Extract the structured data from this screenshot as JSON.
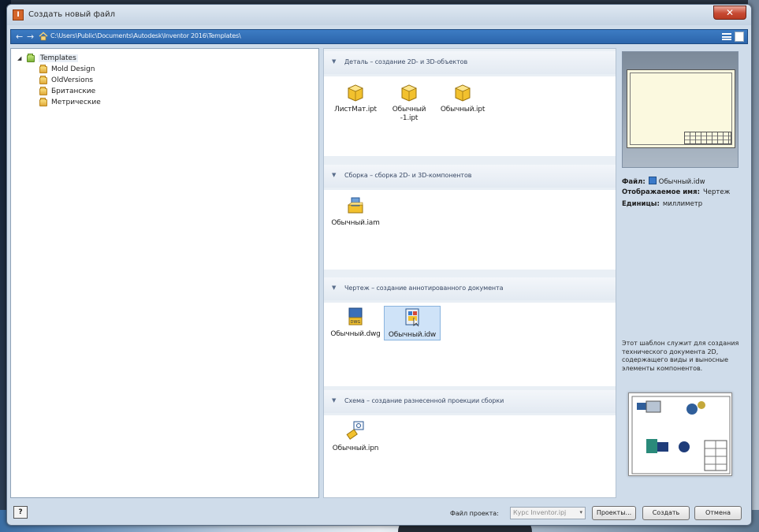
{
  "window": {
    "title": "Создать новый файл",
    "app_icon_glyph": "I",
    "close_glyph": "✕"
  },
  "address_bar": {
    "back_glyph": "←",
    "forward_glyph": "→",
    "path": "C:\\Users\\Public\\Documents\\Autodesk\\Inventor 2016\\Templates\\"
  },
  "tree": {
    "root": {
      "label": "Templates",
      "expander": "◢"
    },
    "children": [
      {
        "label": "Mold Design"
      },
      {
        "label": "OldVersions"
      },
      {
        "label": "Британские"
      },
      {
        "label": "Метрические"
      }
    ]
  },
  "sections": [
    {
      "header": "Деталь – создание 2D- и 3D-объектов",
      "items": [
        {
          "name": "ЛистМат.ipt",
          "icon": "part-icon"
        },
        {
          "name": "Обычный -1.ipt",
          "icon": "part-icon"
        },
        {
          "name": "Обычный.ipt",
          "icon": "part-icon"
        }
      ]
    },
    {
      "header": "Сборка – сборка 2D- и 3D-компонентов",
      "items": [
        {
          "name": "Обычный.iam",
          "icon": "assembly-icon"
        }
      ]
    },
    {
      "header": "Чертеж – создание аннотированного документа",
      "items": [
        {
          "name": "Обычный.dwg",
          "icon": "dwg-icon",
          "badge": "DWG"
        },
        {
          "name": "Обычный.idw",
          "icon": "idw-icon",
          "selected": true
        }
      ]
    },
    {
      "header": "Схема – создание разнесенной проекции сборки",
      "items": [
        {
          "name": "Обычный.ipn",
          "icon": "presentation-icon"
        }
      ]
    }
  ],
  "section_chevron": "▼",
  "preview": {
    "file_label": "Файл:",
    "file_value": "Обычный.idw",
    "display_name_label": "Отображаемое имя:",
    "display_name_value": "Чертеж",
    "units_label": "Единицы:",
    "units_value": "миллиметр",
    "description": "Этот шаблон служит для создания технического документа 2D, содержащего виды и выносные элементы компонентов."
  },
  "bottom": {
    "help_glyph": "?",
    "project_label": "Файл проекта:",
    "project_value": "Курс Inventor.ipj",
    "dropdown_glyph": "▾",
    "projects_button": "Проекты...",
    "create_button": "Создать",
    "cancel_button": "Отмена"
  },
  "colors": {
    "address_bar": "#2c65ab",
    "selection": "#cfe3f8",
    "window_frame": "#cfdcea"
  }
}
